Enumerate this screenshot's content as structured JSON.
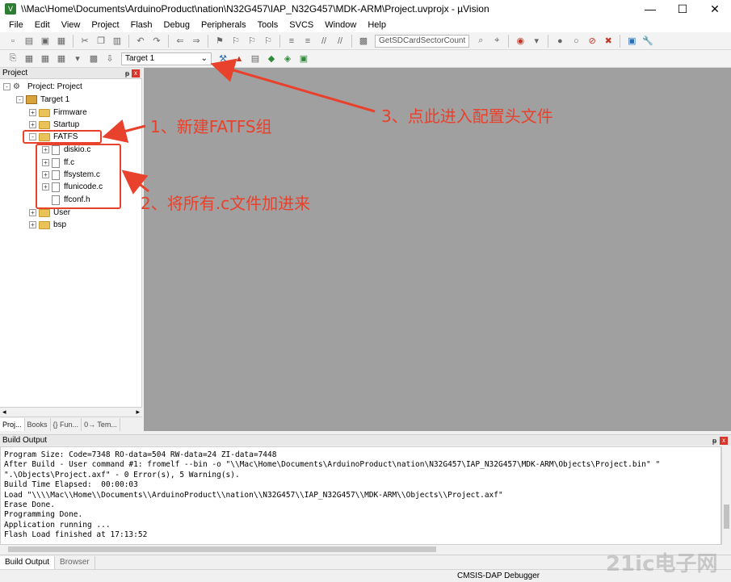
{
  "window": {
    "title": "\\\\Mac\\Home\\Documents\\ArduinoProduct\\nation\\N32G457\\IAP_N32G457\\MDK-ARM\\Project.uvprojx - µVision",
    "minimize": "—",
    "maximize": "☐",
    "close": "✕"
  },
  "menu": [
    "File",
    "Edit",
    "View",
    "Project",
    "Flash",
    "Debug",
    "Peripherals",
    "Tools",
    "SVCS",
    "Window",
    "Help"
  ],
  "toolbar": {
    "function_box": "GetSDCardSectorCount",
    "target_select": "Target 1"
  },
  "project_panel": {
    "header": "Project",
    "pin": "ᵽ",
    "close": "x",
    "tree": [
      {
        "label": "Project: Project",
        "level": 0,
        "type": "project",
        "expander": "-"
      },
      {
        "label": "Target 1",
        "level": 1,
        "type": "target",
        "expander": "-"
      },
      {
        "label": "Firmware",
        "level": 2,
        "type": "folder",
        "expander": "+"
      },
      {
        "label": "Startup",
        "level": 2,
        "type": "folder",
        "expander": "+"
      },
      {
        "label": "FATFS",
        "level": 2,
        "type": "folder",
        "expander": "-"
      },
      {
        "label": "diskio.c",
        "level": 3,
        "type": "file",
        "expander": "+"
      },
      {
        "label": "ff.c",
        "level": 3,
        "type": "file",
        "expander": "+"
      },
      {
        "label": "ffsystem.c",
        "level": 3,
        "type": "file",
        "expander": "+"
      },
      {
        "label": "ffunicode.c",
        "level": 3,
        "type": "file",
        "expander": "+"
      },
      {
        "label": "ffconf.h",
        "level": 3,
        "type": "file",
        "expander": ""
      },
      {
        "label": "User",
        "level": 2,
        "type": "folder",
        "expander": "+"
      },
      {
        "label": "bsp",
        "level": 2,
        "type": "folder",
        "expander": "+"
      }
    ],
    "tabs": [
      "Proj...",
      "Books",
      "{} Fun...",
      "0→ Tem..."
    ]
  },
  "build_output": {
    "header": "Build Output",
    "pin": "ᵽ",
    "close": "x",
    "lines": [
      "Program Size: Code=7348 RO-data=504 RW-data=24 ZI-data=7448",
      "After Build - User command #1: fromelf --bin -o \"\\\\Mac\\Home\\Documents\\ArduinoProduct\\nation\\N32G457\\IAP_N32G457\\MDK-ARM\\Objects\\Project.bin\" \"",
      "\".\\Objects\\Project.axf\" - 0 Error(s), 5 Warning(s).",
      "Build Time Elapsed:  00:00:03",
      "Load \"\\\\\\\\Mac\\\\Home\\\\Documents\\\\ArduinoProduct\\\\nation\\\\N32G457\\\\IAP_N32G457\\\\MDK-ARM\\\\Objects\\\\Project.axf\"",
      "Erase Done.",
      "Programming Done.",
      "Application running ...",
      "Flash Load finished at 17:13:52"
    ],
    "tabs": [
      "Build Output",
      "Browser"
    ]
  },
  "status": {
    "debugger": "CMSIS-DAP Debugger"
  },
  "annotations": {
    "a1": "1、新建FATFS组",
    "a2": "2、将所有.c文件加进来",
    "a3": "3、点此进入配置头文件"
  },
  "watermark": "21ic电子网",
  "colors": {
    "annotation_red": "#e8412c",
    "editor_bg": "#a0a0a0",
    "folder": "#e9c35a"
  }
}
